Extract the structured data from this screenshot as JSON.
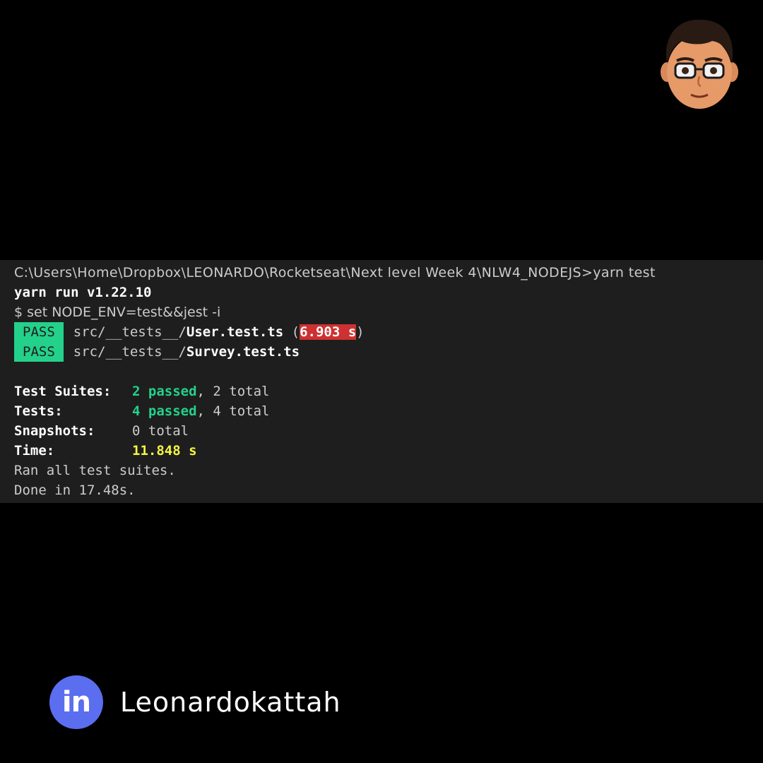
{
  "terminal": {
    "command_line": "C:\\Users\\Home\\Dropbox\\LEONARDO\\Rocketseat\\Next level Week 4\\NLW4_NODEJS>yarn test",
    "yarn_version_line": "yarn run v1.22.10",
    "set_command": "$ set NODE_ENV=test&&jest -i",
    "results": [
      {
        "status": "PASS",
        "path_prefix": "src/__tests__/",
        "file": "User.test.ts",
        "open_paren": " (",
        "duration": "6.903 s",
        "close_paren": ")"
      },
      {
        "status": "PASS",
        "path_prefix": "src/__tests__/",
        "file": "Survey.test.ts"
      }
    ],
    "summary": {
      "suites_label": "Test Suites:",
      "suites_passed": "2 passed",
      "suites_total": ", 2 total",
      "tests_label": "Tests:",
      "tests_passed": "4 passed",
      "tests_total": ", 4 total",
      "snapshots_label": "Snapshots:",
      "snapshots_value": "0 total",
      "time_label": "Time:",
      "time_value": "11.848 s",
      "ran_line": "Ran all test suites.",
      "done_line": "Done in 17.48s."
    }
  },
  "footer": {
    "linkedin_icon_text": "in",
    "handle": "Leonardokattah"
  },
  "colors": {
    "background": "#000000",
    "terminal_bg": "#1e1e1e",
    "pass_green": "#23d18b",
    "slow_red": "#cd3131",
    "time_yellow": "#f5f543",
    "linkedin_blue": "#5b6ef0"
  },
  "icons": {
    "avatar": "cartoon-avatar-with-glasses",
    "linkedin": "linkedin-icon"
  }
}
